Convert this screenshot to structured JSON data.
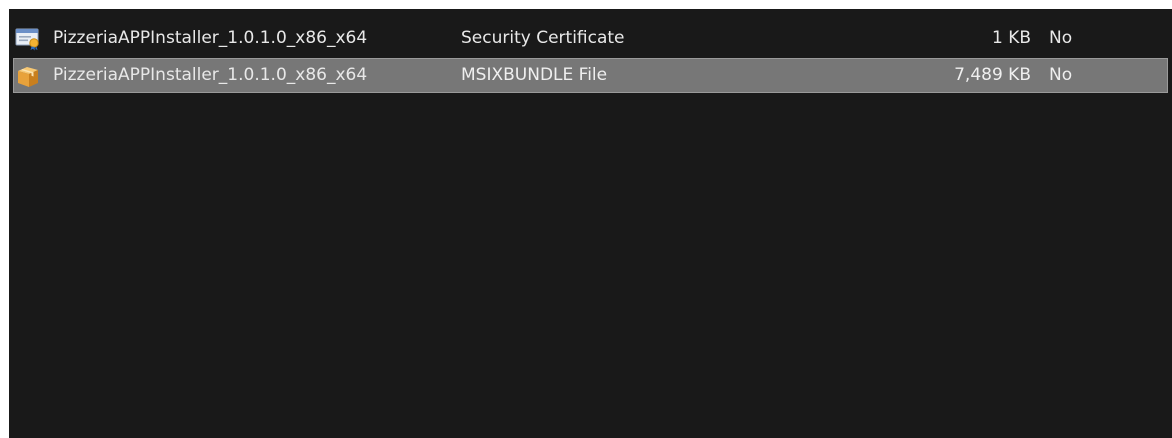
{
  "files": [
    {
      "icon": "security-certificate-icon",
      "name": "PizzeriaAPPInstaller_1.0.1.0_x86_x64",
      "type": "Security Certificate",
      "size": "1 KB",
      "flag": "No",
      "selected": false
    },
    {
      "icon": "package-box-icon",
      "name": "PizzeriaAPPInstaller_1.0.1.0_x86_x64",
      "type": "MSIXBUNDLE File",
      "size": "7,489 KB",
      "flag": "No",
      "selected": true
    }
  ],
  "colors": {
    "pane_background": "#191919",
    "selection": "#777777",
    "text": "#e8e8e8"
  }
}
